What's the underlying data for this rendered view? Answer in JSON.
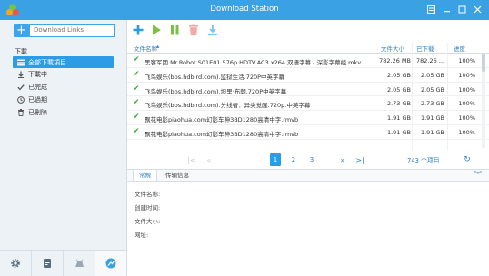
{
  "window": {
    "title": "Download Station"
  },
  "sidebar": {
    "download_links_placeholder": "Download Links",
    "section_label": "下載",
    "items": [
      {
        "label": "全部下載項目",
        "icon": "list-icon"
      },
      {
        "label": "下載中",
        "icon": "download-arrow-icon"
      },
      {
        "label": "已完成",
        "icon": "check-icon"
      },
      {
        "label": "已過期",
        "icon": "clock-icon"
      },
      {
        "label": "已刪除",
        "icon": "trash-icon"
      }
    ]
  },
  "table": {
    "columns": [
      "文件名称",
      "文件大小",
      "已下载",
      "进度"
    ],
    "rows": [
      {
        "name": "黑客军团.Mr.Robot.S01E01.576p.HDTV.AC3.x264.双语字幕 - 深影字幕组.mkv",
        "size": "782.26 MB",
        "downloaded": "782.26 ...",
        "progress": "100%"
      },
      {
        "name": "飞鸟娱乐(bbs.hdbird.com).监狱生活.720P中英字幕",
        "size": "2.05 GB",
        "downloaded": "2.05 GB",
        "progress": "100%"
      },
      {
        "name": "飞鸟娱乐(bbs.hdbird.com).坦里·布朗.720P中英字幕",
        "size": "2.05 GB",
        "downloaded": "2.05 GB",
        "progress": "100%"
      },
      {
        "name": "飞鸟娱乐(bbs.hdbird.com).分线者：异类觉醒.720p.中英字幕",
        "size": "2.73 GB",
        "downloaded": "2.73 GB",
        "progress": "100%"
      },
      {
        "name": "飘花电影piaohua.com幻影车神3BD1280高清中字.rmvb",
        "size": "1.91 GB",
        "downloaded": "1.91 GB",
        "progress": "100%"
      },
      {
        "name": "飘花电影piaohua.com幻影车神3BD1280高清中字.rmvb",
        "size": "1.91 GB",
        "downloaded": "1.91 GB",
        "progress": "100%"
      }
    ]
  },
  "pager": {
    "pages": [
      "1",
      "2",
      "3"
    ],
    "count": "743 个项目"
  },
  "detail": {
    "tabs": [
      "常規",
      "传输信息"
    ],
    "fields": [
      "文件名称:",
      "创建时间:",
      "文件大小:",
      "网址:"
    ]
  },
  "colors": {
    "accent": "#3aa1e5",
    "check": "#3aaa35"
  }
}
